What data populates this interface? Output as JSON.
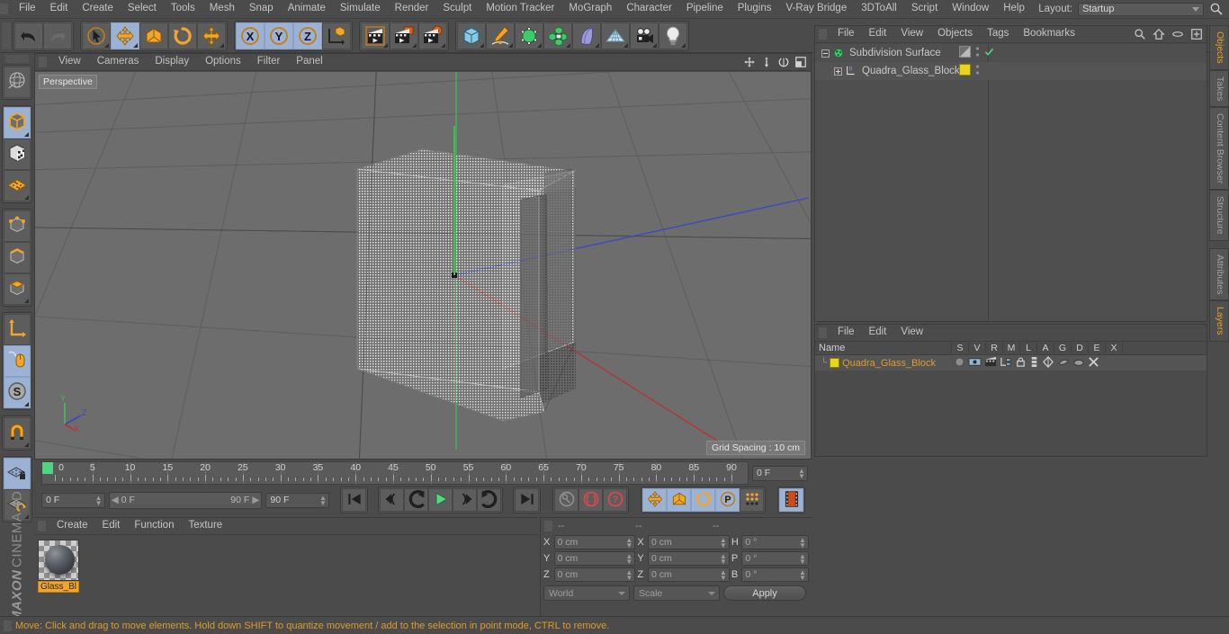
{
  "app": {
    "brand_maxon": "MAXON",
    "brand_c4d": "CINEMA 4D"
  },
  "menubar": {
    "items": [
      "File",
      "Edit",
      "Create",
      "Select",
      "Tools",
      "Mesh",
      "Snap",
      "Animate",
      "Simulate",
      "Render",
      "Sculpt",
      "Motion Tracker",
      "MoGraph",
      "Character",
      "Pipeline",
      "Plugins",
      "V-Ray Bridge",
      "3DToAll",
      "Script",
      "Window",
      "Help"
    ],
    "layout_label": "Layout:",
    "layout_value": "Startup"
  },
  "toolbar": {
    "groups": [
      {
        "name": "history",
        "buttons": [
          {
            "name": "undo-button",
            "icon": "undo-icon",
            "active": false
          },
          {
            "name": "redo-button",
            "icon": "redo-icon",
            "active": false
          }
        ]
      },
      {
        "name": "transform",
        "buttons": [
          {
            "name": "live-selection-button",
            "icon": "cursor-circle-icon",
            "active": false
          },
          {
            "name": "move-tool-button",
            "icon": "move-arrows-icon",
            "active": true
          },
          {
            "name": "scale-tool-button",
            "icon": "scale-box-icon",
            "active": false
          },
          {
            "name": "rotate-tool-button",
            "icon": "rotate-arc-icon",
            "active": false
          },
          {
            "name": "move-secondary-button",
            "icon": "move-arrows-icon",
            "active": false
          }
        ]
      },
      {
        "name": "axis-locks",
        "buttons": [
          {
            "name": "lock-x-button",
            "icon": "x-axis-icon",
            "label": "X",
            "active": true
          },
          {
            "name": "lock-y-button",
            "icon": "y-axis-icon",
            "label": "Y",
            "active": true
          },
          {
            "name": "lock-z-button",
            "icon": "z-axis-icon",
            "label": "Z",
            "active": true
          },
          {
            "name": "world-coordinates-button",
            "icon": "world-axis-cube-icon",
            "active": false
          }
        ]
      },
      {
        "name": "render",
        "buttons": [
          {
            "name": "render-view-button",
            "icon": "clapper-icon",
            "active": false
          },
          {
            "name": "render-to-picture-viewer-button",
            "icon": "clapper-picture-icon",
            "active": false
          },
          {
            "name": "render-settings-button",
            "icon": "clapper-gear-icon",
            "active": false
          }
        ]
      },
      {
        "name": "creation",
        "buttons": [
          {
            "name": "add-cube-button",
            "icon": "cube-icon",
            "active": false
          },
          {
            "name": "add-spline-button",
            "icon": "pen-spline-icon",
            "active": false
          },
          {
            "name": "add-generator-button",
            "icon": "green-cube-icon",
            "active": false
          },
          {
            "name": "add-modeling-object-button",
            "icon": "green-array-icon",
            "active": false
          },
          {
            "name": "add-deformer-button",
            "icon": "bend-deformer-icon",
            "active": false
          },
          {
            "name": "add-environment-button",
            "icon": "floor-grid-icon",
            "active": false
          },
          {
            "name": "add-camera-button",
            "icon": "camera-icon",
            "active": false
          },
          {
            "name": "add-light-button",
            "icon": "light-bulb-icon",
            "active": false
          }
        ]
      }
    ]
  },
  "left_toolbar": {
    "groups": [
      {
        "buttons": [
          {
            "name": "make-editable-button",
            "icon": "globe-wire-icon",
            "active": false
          }
        ]
      },
      {
        "buttons": [
          {
            "name": "model-mode-button",
            "icon": "model-cube-icon",
            "active": true
          },
          {
            "name": "texture-mode-button",
            "icon": "texture-checker-cube-icon",
            "active": false
          },
          {
            "name": "workplane-mode-button",
            "icon": "workplane-grid-icon",
            "active": false
          }
        ]
      },
      {
        "buttons": [
          {
            "name": "points-mode-button",
            "icon": "points-cube-icon",
            "active": false
          },
          {
            "name": "edges-mode-button",
            "icon": "edges-cube-icon",
            "active": false
          },
          {
            "name": "polygons-mode-button",
            "icon": "polygons-cube-icon",
            "active": false
          }
        ]
      },
      {
        "buttons": [
          {
            "name": "object-axis-button",
            "icon": "axis-l-icon",
            "active": false
          },
          {
            "name": "viewport-solo-button",
            "icon": "mouse-icon",
            "active": true
          },
          {
            "name": "enable-snapping-button",
            "icon": "snap-s-icon",
            "active": true
          }
        ]
      },
      {
        "buttons": [
          {
            "name": "magnet-button",
            "icon": "magnet-icon",
            "active": false
          }
        ]
      },
      {
        "buttons": [
          {
            "name": "lock-workplane-button",
            "icon": "workplane-lock-icon",
            "active": true
          },
          {
            "name": "planar-workplane-button",
            "icon": "workplane-rotate-icon",
            "active": false
          }
        ]
      }
    ]
  },
  "viewport": {
    "menu": [
      "View",
      "Cameras",
      "Display",
      "Options",
      "Filter",
      "Panel"
    ],
    "label": "Perspective",
    "grid_spacing": "Grid Spacing : 10 cm",
    "nav_icons": [
      "pan-icon",
      "dolly-icon",
      "orbit-icon",
      "maximize-icon"
    ],
    "axis_labels": {
      "y": "Y",
      "z": "Z",
      "x": "X"
    }
  },
  "timeline": {
    "ticks": [
      0,
      5,
      10,
      15,
      20,
      25,
      30,
      35,
      40,
      45,
      50,
      55,
      60,
      65,
      70,
      75,
      80,
      85,
      90
    ],
    "min_frame": 0,
    "max_frame": 90,
    "current_frame_display": "0 F",
    "current_frame_field": "0 F",
    "range_start": "0 F",
    "range_end": "90 F",
    "end_frame_field": "90 F"
  },
  "transport": {
    "buttons": [
      {
        "name": "go-to-start-button",
        "icon": "skip-start-icon",
        "active": false
      },
      {
        "name": "go-to-previous-key-button",
        "icon": "prev-key-icon",
        "active": false
      },
      {
        "name": "step-back-button",
        "icon": "step-back-icon",
        "active": false
      },
      {
        "name": "play-button",
        "icon": "play-icon",
        "active": false
      },
      {
        "name": "step-forward-button",
        "icon": "step-forward-icon",
        "active": false
      },
      {
        "name": "go-to-next-key-button",
        "icon": "next-key-icon",
        "active": false
      },
      {
        "name": "go-to-end-button",
        "icon": "skip-end-icon",
        "active": false
      }
    ],
    "record_buttons": [
      {
        "name": "autokeying-button",
        "icon": "key-icon",
        "active": false
      },
      {
        "name": "record-active-objects-button",
        "icon": "record-circle-icon",
        "active": false
      },
      {
        "name": "keyframe-selection-button",
        "icon": "question-circle-icon",
        "active": false
      }
    ],
    "key_toggles": [
      {
        "name": "key-position-button",
        "icon": "position-arrows-icon",
        "active": true
      },
      {
        "name": "key-scale-button",
        "icon": "scale-box-icon",
        "active": true
      },
      {
        "name": "key-rotation-button",
        "icon": "rotate-arc-icon",
        "active": true
      },
      {
        "name": "key-parameter-button",
        "icon": "parameter-p-icon",
        "active": true
      },
      {
        "name": "key-pla-button",
        "icon": "point-level-animation-icon",
        "active": false
      }
    ],
    "right_buttons": [
      {
        "name": "timeline-toggle-button",
        "icon": "filmstrip-icon",
        "active": true
      }
    ]
  },
  "material_manager": {
    "menu": [
      "Create",
      "Edit",
      "Function",
      "Texture"
    ],
    "materials": [
      {
        "name": "Glass_Bl",
        "selected": true
      }
    ]
  },
  "coordinates": {
    "header": [
      "--",
      "--",
      "--"
    ],
    "rows": [
      {
        "label_pos": "X",
        "value_pos": "0 cm",
        "label_size": "X",
        "value_size": "0 cm",
        "label_rot": "H",
        "value_rot": "0 °"
      },
      {
        "label_pos": "Y",
        "value_pos": "0 cm",
        "label_size": "Y",
        "value_size": "0 cm",
        "label_rot": "P",
        "value_rot": "0 °"
      },
      {
        "label_pos": "Z",
        "value_pos": "0 cm",
        "label_size": "Z",
        "value_size": "0 cm",
        "label_rot": "B",
        "value_rot": "0 °"
      }
    ],
    "system_select": "World",
    "mode_select": "Scale",
    "apply_label": "Apply"
  },
  "object_manager": {
    "menu": [
      "File",
      "Edit",
      "View",
      "Objects",
      "Tags",
      "Bookmarks"
    ],
    "icons": [
      "search-icon",
      "home-icon",
      "ellipse-icon",
      "add-layout-icon"
    ],
    "rows": [
      {
        "name": "Subdivision Surface",
        "indent": 0,
        "expander": "minus",
        "icon": "subdivision-surface-icon",
        "tag_visible": true,
        "has_check": true
      },
      {
        "name": "Quadra_Glass_Block",
        "indent": 1,
        "expander": "plus",
        "icon": "polygon-object-icon",
        "tag_color": "#e8d321",
        "has_check": false
      }
    ]
  },
  "layer_manager": {
    "menu": [
      "File",
      "Edit",
      "View"
    ],
    "columns": [
      "Name",
      "S",
      "V",
      "R",
      "M",
      "L",
      "A",
      "G",
      "D",
      "E",
      "X"
    ],
    "rows": [
      {
        "name": "Quadra_Glass_Block",
        "color": "#e8d321",
        "icons": [
          "solo-dot-icon",
          "visible-eye-icon",
          "render-clapper-icon",
          "manager-icon",
          "lock-icon",
          "animation-icon",
          "generator-icon",
          "deformer-icon",
          "expression-icon",
          "xref-icon"
        ]
      }
    ]
  },
  "right_tabs": {
    "top": [
      {
        "label": "Objects",
        "active": true
      },
      {
        "label": "Takes",
        "active": false
      },
      {
        "label": "Content Browser",
        "active": false
      },
      {
        "label": "Structure",
        "active": false
      }
    ],
    "bottom": [
      {
        "label": "Attributes",
        "active": false
      },
      {
        "label": "Layers",
        "active": true
      }
    ]
  },
  "statusbar": {
    "message": "Move: Click and drag to move elements. Hold down SHIFT to quantize movement / add to the selection in point mode, CTRL to remove."
  },
  "colors": {
    "accent_orange": "#e09a28",
    "active_blue": "#9bb2d4",
    "panel_bg": "#4b4b4b",
    "viewport_bg": "#6d6d6d",
    "axis_x": "#c03030",
    "axis_y": "#3fbf50",
    "axis_z": "#3a46c8"
  }
}
